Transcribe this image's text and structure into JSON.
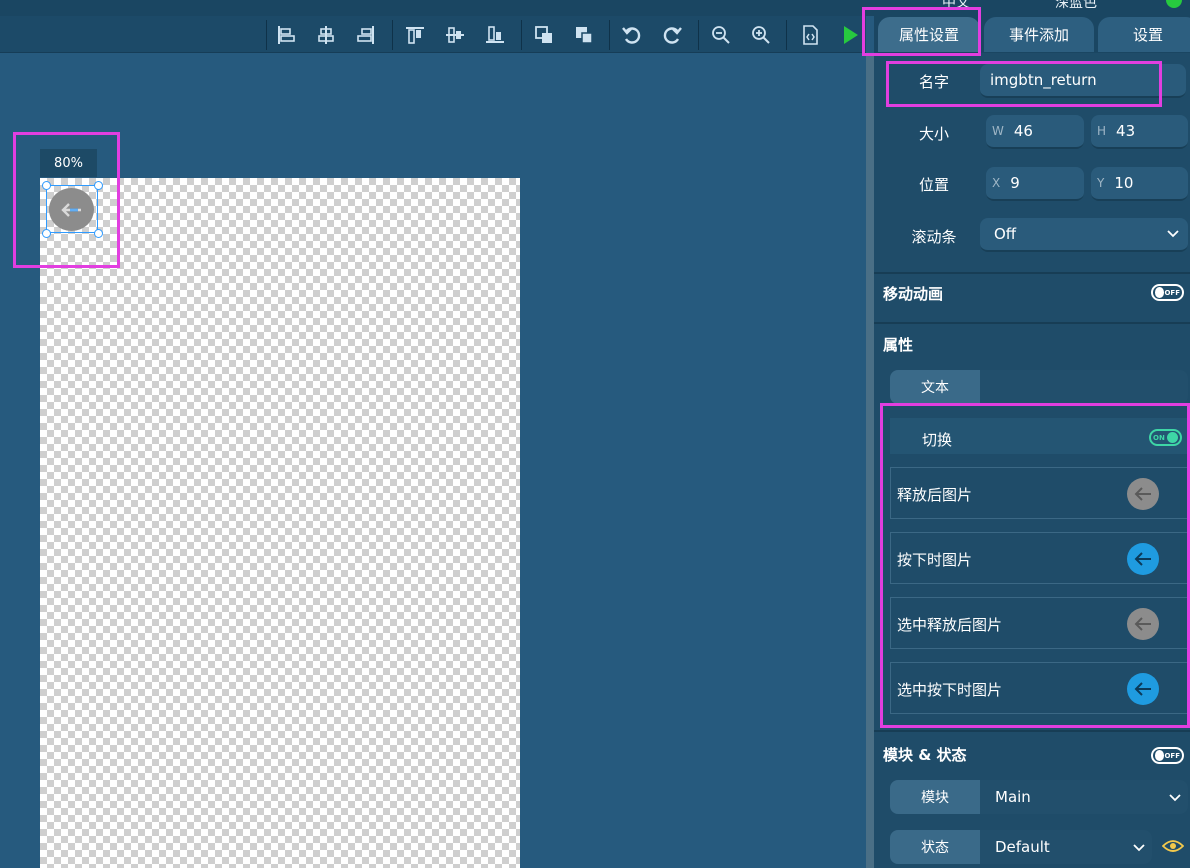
{
  "top_strip": {
    "lang_label": "中文",
    "theme_label": "深蓝色"
  },
  "toolbar": {
    "buttons": [
      "align-left-icon",
      "align-center-h-icon",
      "align-right-icon",
      "align-top-icon",
      "align-middle-v-icon",
      "align-bottom-icon",
      "bring-forward-icon",
      "send-backward-icon",
      "undo-icon",
      "redo-icon",
      "zoom-out-icon",
      "zoom-in-icon",
      "code-view-icon",
      "play-icon"
    ]
  },
  "canvas": {
    "zoom": "80%"
  },
  "tabs": [
    {
      "label": "属性设置",
      "active": true
    },
    {
      "label": "事件添加",
      "active": false
    },
    {
      "label": "设置",
      "active": false
    }
  ],
  "props": {
    "name_label": "名字",
    "name_value": "imgbtn_return",
    "size_label": "大小",
    "w_prefix": "W",
    "w_value": "46",
    "h_prefix": "H",
    "h_value": "43",
    "pos_label": "位置",
    "x_prefix": "X",
    "x_value": "9",
    "y_prefix": "Y",
    "y_value": "10",
    "scroll_label": "滚动条",
    "scroll_value": "Off"
  },
  "move_anim": {
    "title": "移动动画",
    "toggle": "OFF"
  },
  "attributes": {
    "title": "属性",
    "text_tab": "文本",
    "switch_label": "切换",
    "switch_toggle": "ON",
    "images": [
      {
        "label": "释放后图片",
        "color": "#8c8c8c"
      },
      {
        "label": "按下时图片",
        "color": "#1f9be0"
      },
      {
        "label": "选中释放后图片",
        "color": "#8c8c8c"
      },
      {
        "label": "选中按下时图片",
        "color": "#1f9be0"
      }
    ]
  },
  "module_state": {
    "title": "模块 & 状态",
    "toggle": "OFF",
    "module_label": "模块",
    "module_value": "Main",
    "state_label": "状态",
    "state_value": "Default"
  },
  "colors": {
    "accent_green": "#27c93f",
    "highlight": "#e23ee0",
    "on_toggle": "#3ed6a6"
  }
}
